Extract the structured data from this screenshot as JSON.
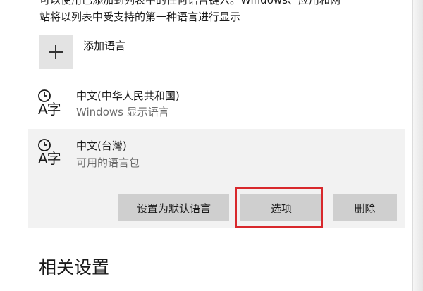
{
  "description": {
    "line1": "可以使用已添加到列表中的任何语言键入。Windows、应用和网",
    "line2": "站将以列表中受支持的第一种语言进行显示"
  },
  "add_language": {
    "label": "添加语言",
    "icon": "plus-icon"
  },
  "languages": [
    {
      "name": "中文(中华人民共和国)",
      "subtitle": "Windows 显示语言",
      "icon": "language-icon",
      "icon_text": "A字",
      "selected": false
    },
    {
      "name": "中文(台灣)",
      "subtitle": "可用的语言包",
      "icon": "language-icon",
      "icon_text": "A字",
      "selected": true
    }
  ],
  "actions": {
    "set_default": "设置为默认语言",
    "options": "选项",
    "remove": "删除"
  },
  "related_settings": {
    "title": "相关设置"
  },
  "colors": {
    "highlight": "#d8282c",
    "selected_bg": "#f2f2f2",
    "button_bg": "#cfcfcf"
  }
}
